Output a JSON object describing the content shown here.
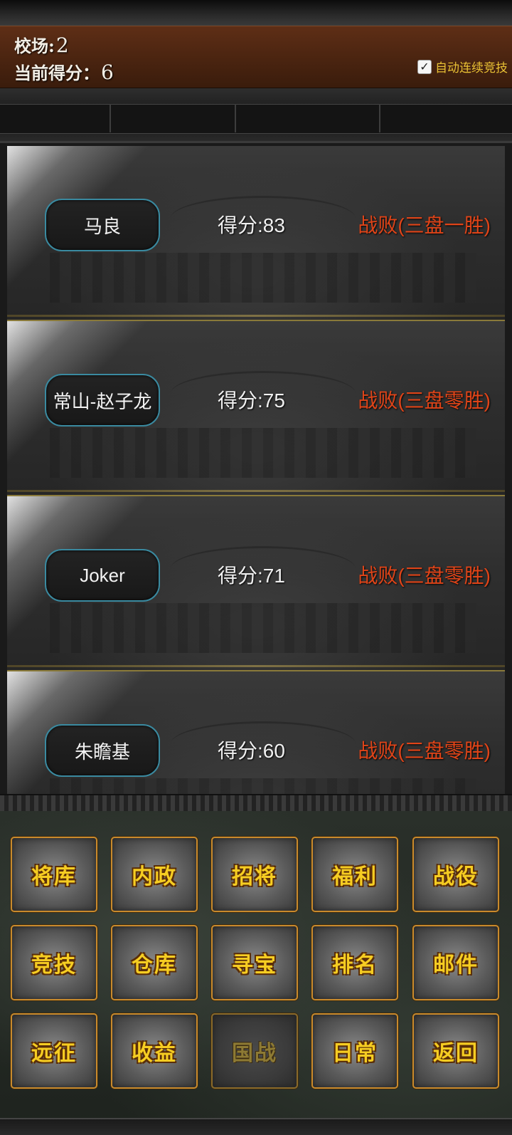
{
  "header": {
    "arena_label": "校场:",
    "arena_value": "2",
    "score_label": "当前得分：",
    "score_value": "6",
    "auto_label": "自动连续竞技",
    "auto_checked_glyph": "✓"
  },
  "rankings": [
    {
      "name": "马良",
      "score": "得分:83",
      "result": "战败(三盘一胜)"
    },
    {
      "name": "常山-赵子龙",
      "score": "得分:75",
      "result": "战败(三盘零胜)"
    },
    {
      "name": "Joker",
      "score": "得分:71",
      "result": "战败(三盘零胜)"
    },
    {
      "name": "朱瞻基",
      "score": "得分:60",
      "result": "战败(三盘零胜)"
    }
  ],
  "menu": [
    {
      "label": "将库"
    },
    {
      "label": "内政"
    },
    {
      "label": "招将"
    },
    {
      "label": "福利"
    },
    {
      "label": "战役"
    },
    {
      "label": "竞技"
    },
    {
      "label": "仓库"
    },
    {
      "label": "寻宝"
    },
    {
      "label": "排名"
    },
    {
      "label": "邮件"
    },
    {
      "label": "远征"
    },
    {
      "label": "收益"
    },
    {
      "label": "国战"
    },
    {
      "label": "日常"
    },
    {
      "label": "返回"
    }
  ],
  "colors": {
    "result_red": "#e04418",
    "menu_gold": "#f6cd22",
    "auto_yellow": "#e8c034"
  }
}
